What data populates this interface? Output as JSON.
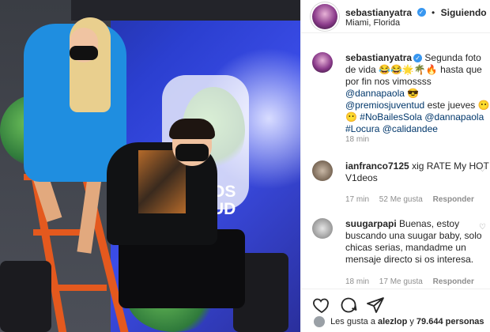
{
  "post": {
    "username": "sebastianyatra",
    "follow_label": "Siguiendo",
    "location": "Miami, Florida",
    "caption_emoji_1": "😂😂🌟🌴🔥",
    "caption_emoji_2": "😎",
    "caption_emoji_3": "😶😶",
    "caption_time": "18 min",
    "caption_parts": {
      "p1": "Segunda foto de vida",
      "p2": "hasta que por fin nos vimossss",
      "m1": "@dannapaola",
      "m2": "@premiosjuventud",
      "p3": "este jueves",
      "h1": "#NoBailesSola",
      "m3": "@dannapaola",
      "h2": "#Locura",
      "m4": "@calidandee"
    }
  },
  "comments": [
    {
      "username": "ianfranco7125",
      "text": "xig RATE My HOT V1deos",
      "time": "17 min",
      "likes": "52 Me gusta",
      "reply": "Responder"
    },
    {
      "username": "suugarpapi",
      "text": "Buenas, estoy buscando una suugar baby, solo chicas serias, mandadme un mensaje directo si os interesa.",
      "time": "18 min",
      "likes": "17 Me gusta",
      "reply": "Responder"
    }
  ],
  "footer": {
    "likes_prefix": "Les gusta a",
    "likes_user": "alezlop",
    "likes_mid": "y",
    "likes_count": "79.644 personas"
  },
  "icons": {
    "like": "heart-icon",
    "comment": "comment-icon",
    "share": "share-icon",
    "verified": "verified-badge-icon"
  }
}
